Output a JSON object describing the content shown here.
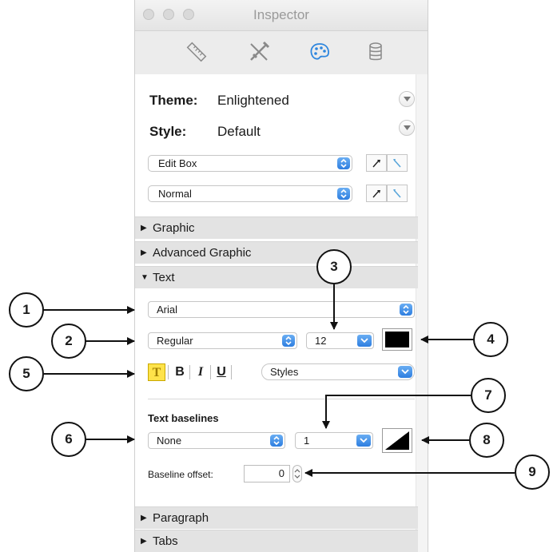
{
  "window": {
    "title": "Inspector"
  },
  "toolbar": {
    "icons": [
      "ruler-icon",
      "tools-icon",
      "palette-icon",
      "database-icon"
    ],
    "active": "palette-icon",
    "accent_color": "#2e86de"
  },
  "theme": {
    "label": "Theme:",
    "value": "Enlightened"
  },
  "style": {
    "label": "Style:",
    "value": "Default"
  },
  "object_popup": {
    "value": "Edit Box"
  },
  "state_popup": {
    "value": "Normal"
  },
  "sections": {
    "graphic": "Graphic",
    "advanced_graphic": "Advanced Graphic",
    "text": "Text",
    "paragraph": "Paragraph",
    "tabs": "Tabs"
  },
  "text": {
    "font": "Arial",
    "font_style": "Regular",
    "font_size": "12",
    "text_color": "#000000",
    "highlight_glyph": "T",
    "bold": "B",
    "italic": "I",
    "underline": "U",
    "styles": "Styles"
  },
  "baselines": {
    "heading": "Text baselines",
    "type": "None",
    "width": "1",
    "offset_label": "Baseline offset:",
    "offset_value": "0"
  },
  "callouts": [
    "1",
    "2",
    "3",
    "4",
    "5",
    "6",
    "7",
    "8",
    "9"
  ]
}
